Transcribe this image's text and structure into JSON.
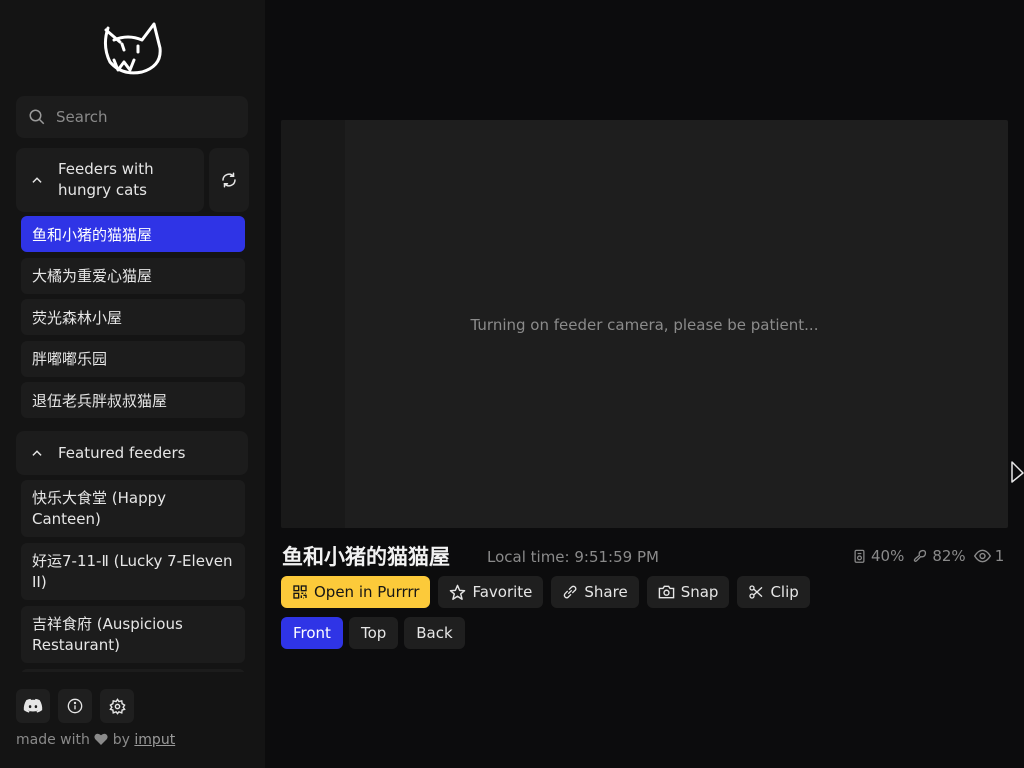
{
  "sidebar": {
    "search_placeholder": "Search",
    "hungry_section": {
      "title": "Feeders with hungry cats",
      "items": [
        "鱼和小猪的猫猫屋",
        "大橘为重爱心猫屋",
        "荧光森林小屋",
        "胖嘟嘟乐园",
        "退伍老兵胖叔叔猫屋"
      ]
    },
    "featured_section": {
      "title": "Featured feeders",
      "items": [
        "快乐大食堂 (Happy Canteen)",
        "好运7-11-Ⅱ (Lucky 7-Eleven II)",
        "吉祥食府 (Auspicious Restaurant)"
      ]
    },
    "footer": {
      "icons": [
        "discord-icon",
        "info-icon",
        "settings-icon"
      ],
      "made_with": "made with",
      "by": "by",
      "author": "imput"
    }
  },
  "main": {
    "video_message": "Turning on feeder camera, please be patient...",
    "feeder_title": "鱼和小猪的猫猫屋",
    "local_time": "Local time: 9:51:59 PM",
    "stats": {
      "food": "40%",
      "battery": "82%",
      "viewers": "1"
    },
    "actions": {
      "open": "Open in Purrrr",
      "favorite": "Favorite",
      "share": "Share",
      "snap": "Snap",
      "clip": "Clip"
    },
    "views": [
      "Front",
      "Top",
      "Back"
    ]
  },
  "colors": {
    "accent": "#2f34e6",
    "primary_button": "#fcca3a"
  }
}
